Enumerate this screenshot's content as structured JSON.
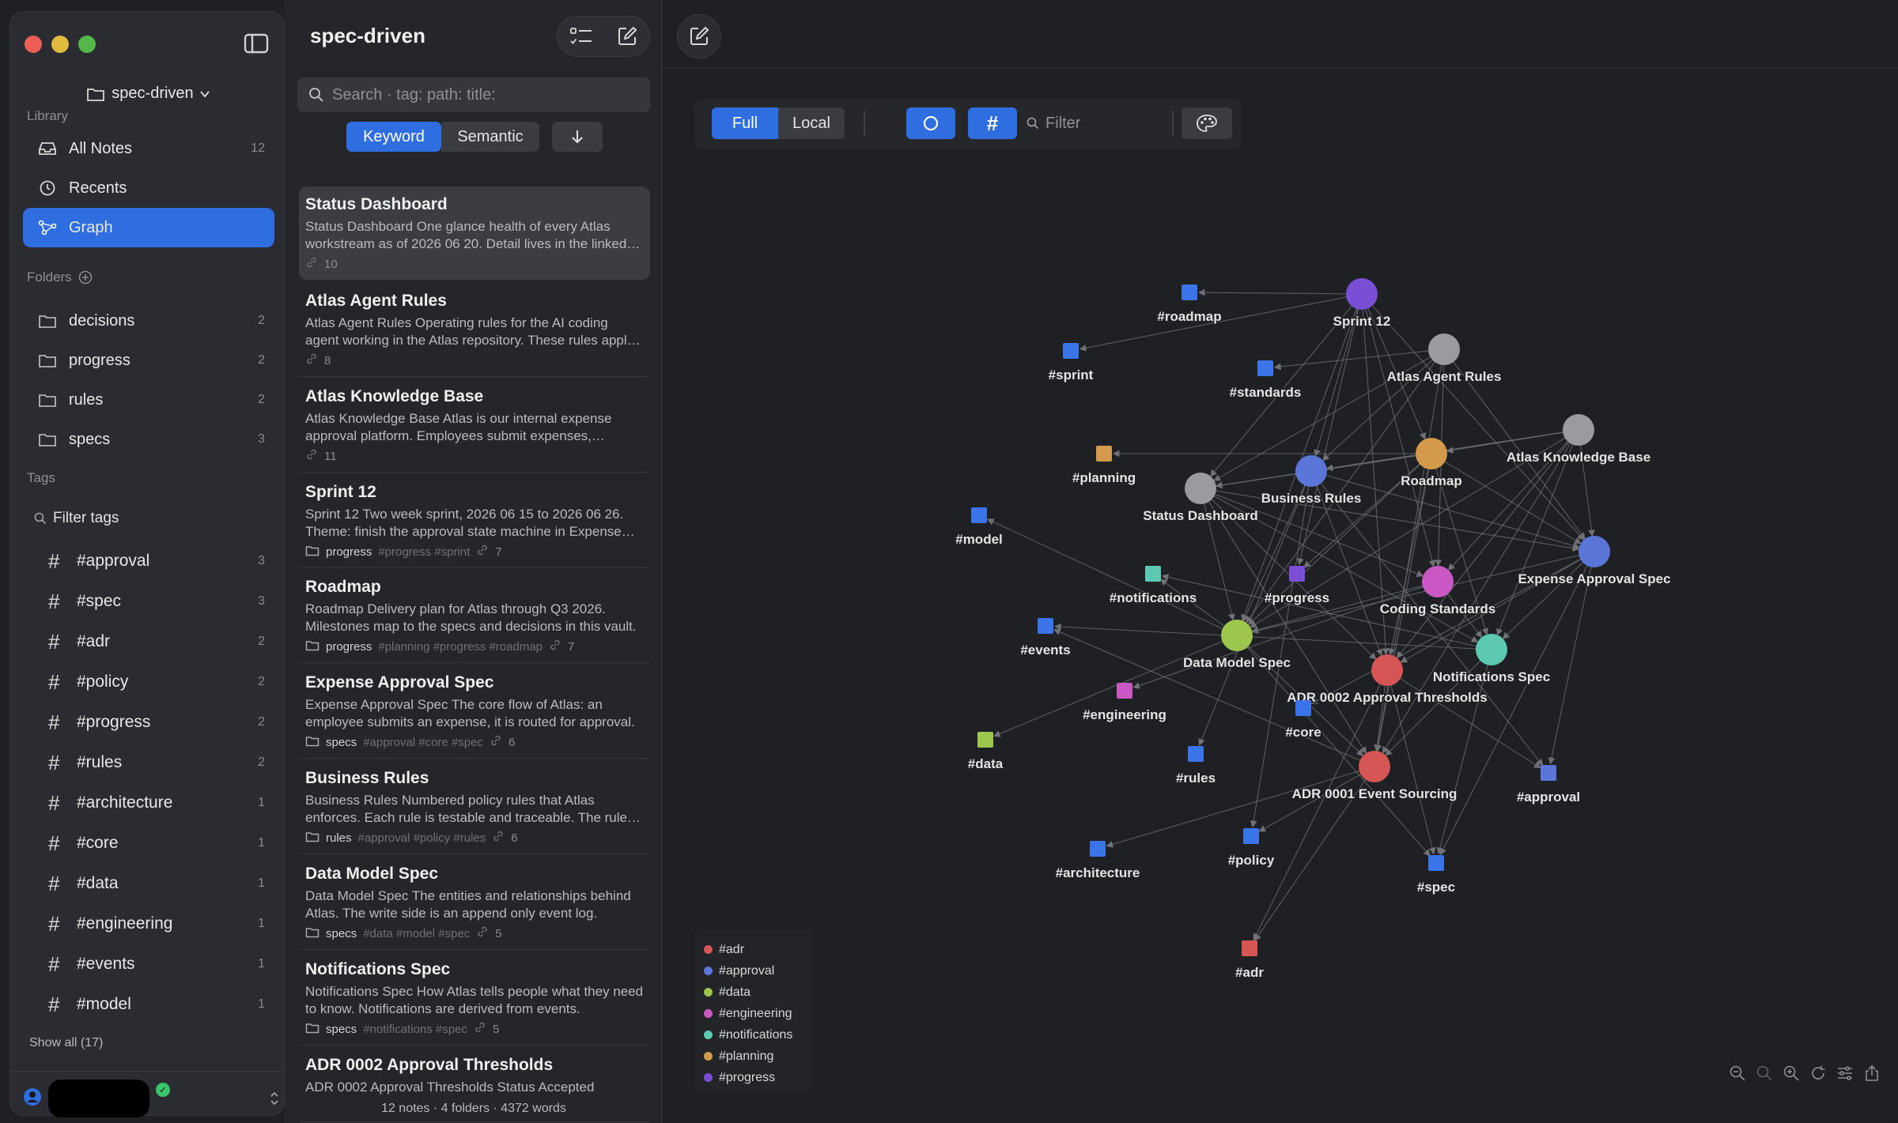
{
  "sidebar": {
    "vault_name": "spec-driven",
    "library_label": "Library",
    "nav": [
      {
        "label": "All Notes",
        "count": "12",
        "icon": "inbox-icon"
      },
      {
        "label": "Recents",
        "count": "",
        "icon": "clock-icon"
      },
      {
        "label": "Graph",
        "count": "",
        "icon": "graph-icon"
      }
    ],
    "folders_label": "Folders",
    "folders": [
      {
        "label": "decisions",
        "count": "2"
      },
      {
        "label": "progress",
        "count": "2"
      },
      {
        "label": "rules",
        "count": "2"
      },
      {
        "label": "specs",
        "count": "3"
      }
    ],
    "tags_label": "Tags",
    "filter_tags_label": "Filter tags",
    "tags": [
      {
        "label": "#approval",
        "count": "3"
      },
      {
        "label": "#spec",
        "count": "3"
      },
      {
        "label": "#adr",
        "count": "2"
      },
      {
        "label": "#policy",
        "count": "2"
      },
      {
        "label": "#progress",
        "count": "2"
      },
      {
        "label": "#rules",
        "count": "2"
      },
      {
        "label": "#architecture",
        "count": "1"
      },
      {
        "label": "#core",
        "count": "1"
      },
      {
        "label": "#data",
        "count": "1"
      },
      {
        "label": "#engineering",
        "count": "1"
      },
      {
        "label": "#events",
        "count": "1"
      },
      {
        "label": "#model",
        "count": "1"
      }
    ],
    "show_all_label": "Show all (17)"
  },
  "notelist": {
    "title": "spec-driven",
    "search_placeholder": "Search  ·  tag: path: title:",
    "mode_keyword": "Keyword",
    "mode_semantic": "Semantic",
    "notes": [
      {
        "title": "Status Dashboard",
        "snippet": "Status Dashboard One glance health of every Atlas workstream as of 2026 06 20. Detail lives in the linked notes.",
        "folder": "",
        "tags": "",
        "links": "10"
      },
      {
        "title": "Atlas Agent Rules",
        "snippet": "Atlas Agent Rules Operating rules for the AI coding agent working in the Atlas repository. These rules apply to every change.",
        "folder": "",
        "tags": "",
        "links": "8"
      },
      {
        "title": "Atlas Knowledge Base",
        "snippet": "Atlas Knowledge Base Atlas is our internal expense approval platform. Employees submit expenses, managers approve.",
        "folder": "",
        "tags": "",
        "links": "11"
      },
      {
        "title": "Sprint 12",
        "snippet": "Sprint 12 Two week sprint, 2026 06 15 to 2026 06 26. Theme: finish the approval state machine in Expense Approval Spec.",
        "folder": "progress",
        "tags": "#progress #sprint",
        "links": "7"
      },
      {
        "title": "Roadmap",
        "snippet": "Roadmap Delivery plan for Atlas through Q3 2026. Milestones map to the specs and decisions in this vault.",
        "folder": "progress",
        "tags": "#planning #progress #roadmap",
        "links": "7"
      },
      {
        "title": "Expense Approval Spec",
        "snippet": "Expense Approval Spec The core flow of Atlas: an employee submits an expense, it is routed for approval.",
        "folder": "specs",
        "tags": "#approval #core #spec",
        "links": "6"
      },
      {
        "title": "Business Rules",
        "snippet": "Business Rules Numbered policy rules that Atlas enforces. Each rule is testable and traceable. The rules apply.",
        "folder": "rules",
        "tags": "#approval #policy #rules",
        "links": "6"
      },
      {
        "title": "Data Model Spec",
        "snippet": "Data Model Spec The entities and relationships behind Atlas. The write side is an append only event log.",
        "folder": "specs",
        "tags": "#data #model #spec",
        "links": "5"
      },
      {
        "title": "Notifications Spec",
        "snippet": "Notifications Spec How Atlas tells people what they need to know. Notifications are derived from events.",
        "folder": "specs",
        "tags": "#notifications #spec",
        "links": "5"
      },
      {
        "title": "ADR 0002 Approval Thresholds",
        "snippet": "ADR 0002 Approval Thresholds Status Accepted",
        "folder": "",
        "tags": "",
        "links": ""
      }
    ],
    "footer": "12 notes  ·  4 folders  ·  4372 words"
  },
  "graph": {
    "mode_full": "Full",
    "mode_local": "Local",
    "hash_label": "#",
    "filter_placeholder": "Filter",
    "colors": {
      "note_gray": "#9a9b9e",
      "tag_blue": "#3a74e8",
      "edge": "#6f7176"
    },
    "nodes": [
      {
        "id": "sprint12",
        "label": "Sprint 12",
        "kind": "note",
        "color": "#7a4fd6"
      },
      {
        "id": "agentrules",
        "label": "Atlas Agent Rules",
        "kind": "note",
        "color": "#9a9b9e"
      },
      {
        "id": "kb",
        "label": "Atlas Knowledge Base",
        "kind": "note",
        "color": "#9a9b9e"
      },
      {
        "id": "roadmap",
        "label": "Roadmap",
        "kind": "note",
        "color": "#d49a4c"
      },
      {
        "id": "bizrules",
        "label": "Business Rules",
        "kind": "note",
        "color": "#5a76d8"
      },
      {
        "id": "status",
        "label": "Status Dashboard",
        "kind": "note",
        "color": "#9a9b9e"
      },
      {
        "id": "expense",
        "label": "Expense Approval Spec",
        "kind": "note",
        "color": "#5a76d8"
      },
      {
        "id": "coding",
        "label": "Coding Standards",
        "kind": "note",
        "color": "#c957c4"
      },
      {
        "id": "datamodel",
        "label": "Data Model Spec",
        "kind": "note",
        "color": "#9cc64c"
      },
      {
        "id": "notif",
        "label": "Notifications Spec",
        "kind": "note",
        "color": "#5cc9b0"
      },
      {
        "id": "adr2",
        "label": "ADR 0002 Approval Thresholds",
        "kind": "note",
        "color": "#d65555"
      },
      {
        "id": "adr1",
        "label": "ADR 0001 Event Sourcing",
        "kind": "note",
        "color": "#d65555"
      },
      {
        "id": "t_roadmap",
        "label": "#roadmap",
        "kind": "tag",
        "color": "#3a74e8"
      },
      {
        "id": "t_sprint",
        "label": "#sprint",
        "kind": "tag",
        "color": "#3a74e8"
      },
      {
        "id": "t_standards",
        "label": "#standards",
        "kind": "tag",
        "color": "#3a74e8"
      },
      {
        "id": "t_planning",
        "label": "#planning",
        "kind": "tag",
        "color": "#d49a4c"
      },
      {
        "id": "t_model",
        "label": "#model",
        "kind": "tag",
        "color": "#3a74e8"
      },
      {
        "id": "t_notifications",
        "label": "#notifications",
        "kind": "tag",
        "color": "#5cc9b0"
      },
      {
        "id": "t_progress",
        "label": "#progress",
        "kind": "tag",
        "color": "#7a4fd6"
      },
      {
        "id": "t_events",
        "label": "#events",
        "kind": "tag",
        "color": "#3a74e8"
      },
      {
        "id": "t_engineering",
        "label": "#engineering",
        "kind": "tag",
        "color": "#c957c4"
      },
      {
        "id": "t_core",
        "label": "#core",
        "kind": "tag",
        "color": "#3a74e8"
      },
      {
        "id": "t_data",
        "label": "#data",
        "kind": "tag",
        "color": "#9cc64c"
      },
      {
        "id": "t_rules",
        "label": "#rules",
        "kind": "tag",
        "color": "#3a74e8"
      },
      {
        "id": "t_approval",
        "label": "#approval",
        "kind": "tag",
        "color": "#5a76d8"
      },
      {
        "id": "t_architecture",
        "label": "#architecture",
        "kind": "tag",
        "color": "#3a74e8"
      },
      {
        "id": "t_policy",
        "label": "#policy",
        "kind": "tag",
        "color": "#3a74e8"
      },
      {
        "id": "t_spec",
        "label": "#spec",
        "kind": "tag",
        "color": "#3a74e8"
      },
      {
        "id": "t_adr",
        "label": "#adr",
        "kind": "tag",
        "color": "#d65555"
      }
    ],
    "edges": [
      [
        "sprint12",
        "t_roadmap"
      ],
      [
        "sprint12",
        "t_sprint"
      ],
      [
        "sprint12",
        "status"
      ],
      [
        "sprint12",
        "bizrules"
      ],
      [
        "sprint12",
        "roadmap"
      ],
      [
        "sprint12",
        "datamodel"
      ],
      [
        "sprint12",
        "adr2"
      ],
      [
        "sprint12",
        "coding"
      ],
      [
        "sprint12",
        "expense"
      ],
      [
        "sprint12",
        "t_progress"
      ],
      [
        "agentrules",
        "t_standards"
      ],
      [
        "agentrules",
        "status"
      ],
      [
        "agentrules",
        "coding"
      ],
      [
        "agentrules",
        "expense"
      ],
      [
        "agentrules",
        "datamodel"
      ],
      [
        "agentrules",
        "adr1"
      ],
      [
        "agentrules",
        "bizrules"
      ],
      [
        "kb",
        "roadmap"
      ],
      [
        "kb",
        "status"
      ],
      [
        "kb",
        "bizrules"
      ],
      [
        "kb",
        "expense"
      ],
      [
        "kb",
        "datamodel"
      ],
      [
        "kb",
        "notif"
      ],
      [
        "kb",
        "adr1"
      ],
      [
        "kb",
        "adr2"
      ],
      [
        "kb",
        "coding"
      ],
      [
        "roadmap",
        "t_planning"
      ],
      [
        "roadmap",
        "status"
      ],
      [
        "roadmap",
        "expense"
      ],
      [
        "roadmap",
        "datamodel"
      ],
      [
        "roadmap",
        "notif"
      ],
      [
        "roadmap",
        "adr1"
      ],
      [
        "roadmap",
        "adr2"
      ],
      [
        "roadmap",
        "t_progress"
      ],
      [
        "bizrules",
        "expense"
      ],
      [
        "bizrules",
        "adr2"
      ],
      [
        "bizrules",
        "datamodel"
      ],
      [
        "bizrules",
        "t_rules"
      ],
      [
        "bizrules",
        "t_policy"
      ],
      [
        "bizrules",
        "t_approval"
      ],
      [
        "status",
        "expense"
      ],
      [
        "status",
        "datamodel"
      ],
      [
        "status",
        "notif"
      ],
      [
        "status",
        "adr1"
      ],
      [
        "status",
        "adr2"
      ],
      [
        "status",
        "coding"
      ],
      [
        "expense",
        "datamodel"
      ],
      [
        "expense",
        "adr2"
      ],
      [
        "expense",
        "notif"
      ],
      [
        "expense",
        "t_approval"
      ],
      [
        "expense",
        "t_core"
      ],
      [
        "expense",
        "t_spec"
      ],
      [
        "coding",
        "t_engineering"
      ],
      [
        "coding",
        "datamodel"
      ],
      [
        "coding",
        "notif"
      ],
      [
        "datamodel",
        "t_model"
      ],
      [
        "datamodel",
        "t_data"
      ],
      [
        "datamodel",
        "adr1"
      ],
      [
        "datamodel",
        "t_spec"
      ],
      [
        "datamodel",
        "t_notifications"
      ],
      [
        "notif",
        "t_notifications"
      ],
      [
        "notif",
        "t_events"
      ],
      [
        "notif",
        "t_spec"
      ],
      [
        "notif",
        "adr1"
      ],
      [
        "adr2",
        "adr1"
      ],
      [
        "adr2",
        "t_adr"
      ],
      [
        "adr2",
        "t_approval"
      ],
      [
        "adr2",
        "t_spec"
      ],
      [
        "adr1",
        "t_architecture"
      ],
      [
        "adr1",
        "t_events"
      ],
      [
        "adr1",
        "t_adr"
      ],
      [
        "adr1",
        "t_policy"
      ]
    ],
    "legend": [
      {
        "label": "#adr",
        "color": "#d65555"
      },
      {
        "label": "#approval",
        "color": "#5a76d8"
      },
      {
        "label": "#data",
        "color": "#9cc64c"
      },
      {
        "label": "#engineering",
        "color": "#c957c4"
      },
      {
        "label": "#notifications",
        "color": "#5cc9b0"
      },
      {
        "label": "#planning",
        "color": "#d49a4c"
      },
      {
        "label": "#progress",
        "color": "#7a4fd6"
      }
    ]
  }
}
